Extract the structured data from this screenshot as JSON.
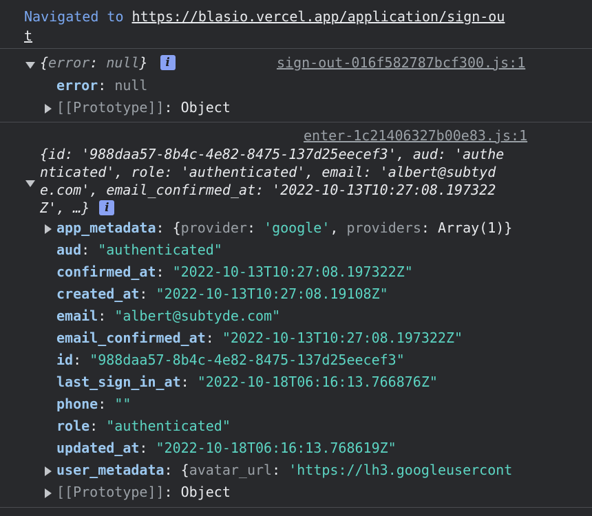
{
  "nav": {
    "prefix": "Navigated to ",
    "url_line1": "https://blasio.vercel.app/application/sign-ou",
    "url_line2": "t"
  },
  "entry1": {
    "summary_open": "{",
    "summary_key": "error",
    "summary_sep": ": ",
    "summary_val": "null",
    "summary_close": "}",
    "info_glyph": "i",
    "source": "sign-out-016f582787bcf300.js:1",
    "prop_key": "error",
    "prop_val": "null",
    "proto_key": "[[Prototype]]",
    "proto_val": "Object"
  },
  "entry2": {
    "source": "enter-1c21406327b00e83.js:1",
    "summary_lines": [
      "{id: '988daa57-8b4c-4e82-8475-137d25eecef3', aud: 'authe",
      "nticated', role: 'authenticated', email: 'albert@subtyd",
      "e.com', email_confirmed_at: '2022-10-13T10:27:08.197322",
      "Z', …}"
    ],
    "info_glyph": "i",
    "app_metadata": {
      "key": "app_metadata",
      "open": "{",
      "k1": "provider",
      "v1": "'google'",
      "k2": "providers",
      "v2": "Array(1)",
      "close": "}"
    },
    "props": [
      {
        "key": "aud",
        "val": "\"authenticated\""
      },
      {
        "key": "confirmed_at",
        "val": "\"2022-10-13T10:27:08.197322Z\""
      },
      {
        "key": "created_at",
        "val": "\"2022-10-13T10:27:08.19108Z\""
      },
      {
        "key": "email",
        "val": "\"albert@subtyde.com\""
      },
      {
        "key": "email_confirmed_at",
        "val": "\"2022-10-13T10:27:08.197322Z\""
      },
      {
        "key": "id",
        "val": "\"988daa57-8b4c-4e82-8475-137d25eecef3\""
      },
      {
        "key": "last_sign_in_at",
        "val": "\"2022-10-18T06:16:13.766876Z\""
      },
      {
        "key": "phone",
        "val": "\"\""
      },
      {
        "key": "role",
        "val": "\"authenticated\""
      },
      {
        "key": "updated_at",
        "val": "\"2022-10-18T06:16:13.768619Z\""
      }
    ],
    "user_metadata": {
      "key": "user_metadata",
      "open": "{",
      "k1": "avatar_url",
      "v1": "'https://lh3.googleusercont"
    },
    "proto_key": "[[Prototype]]",
    "proto_val": "Object"
  }
}
